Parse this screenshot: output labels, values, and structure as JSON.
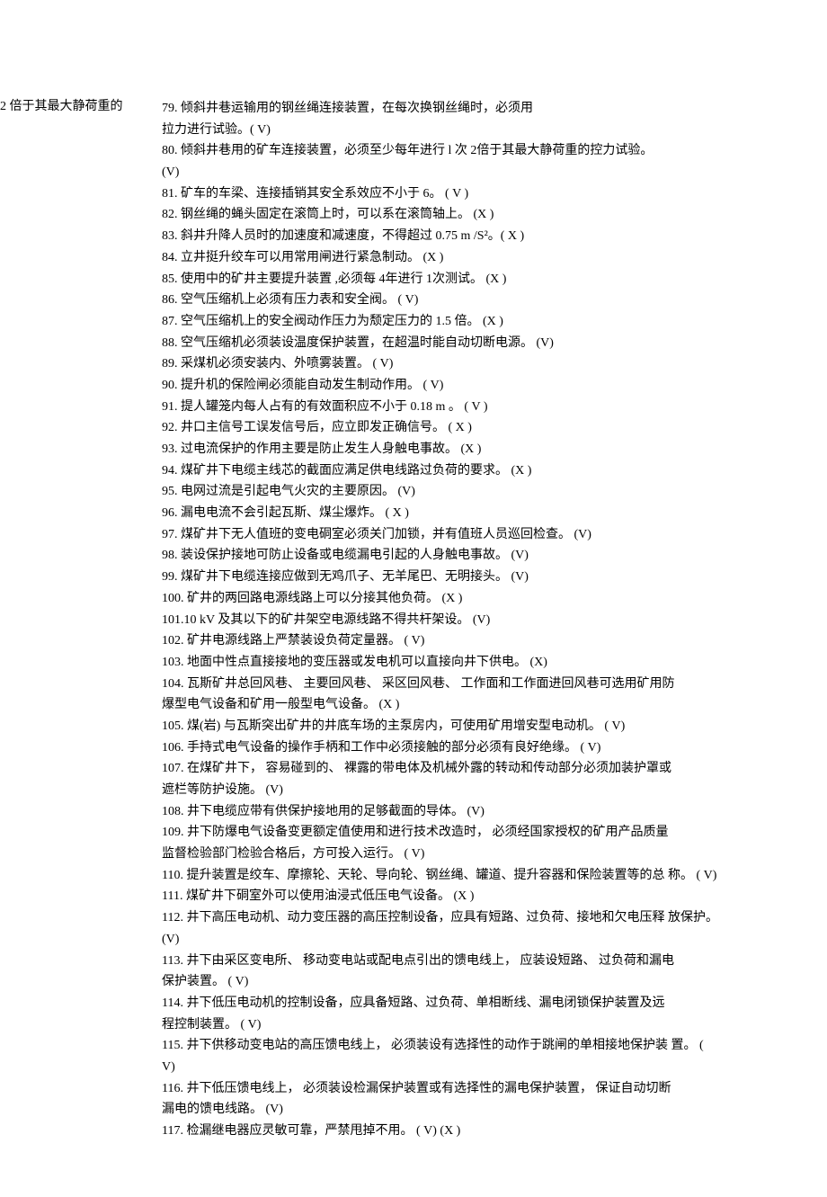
{
  "margin_note": "2 倍于其最大静荷重的",
  "items": [
    "79.  倾斜井巷运输用的钢丝绳连接装置，在每次换钢丝绳时，必须用",
    "拉力进行试验。( V)",
    "80.  倾斜井巷用的矿车连接装置，必须至少每年进行       l 次  2倍于其最大静荷重的控力试验。",
    "(V)",
    "81.  矿车的车梁、连接插销其安全系效应不小于       6。   ( V )",
    "82.  钢丝绳的蝇头固定在滚筒上时，可以系在滚筒轴上。         (X )",
    "83.  斜井升降人员时的加速度和减速度，不得超过       0.75 m /S²。( X )",
    "84.  立井挺升绞车可以用常用闸进行紧急制动。  (X )",
    "85.  使用中的矿井主要提升装置 ,必须每 4年进行 1次测试。  (X )",
    "86.  空气压缩机上必须有压力表和安全阀。     ( V)",
    "87.  空气压缩机上的安全阀动作压力为颓定压力的  1.5 倍。   (X )",
    "88.  空气压缩机必须装设温度保护装置，在超温时能自动切断电源。          (V)",
    "89.  采煤机必须安装内、外喷雾装置。  ( V)",
    "90.  提升机的保险闸必须能自动发生制动作用。  ( V)",
    "91.  提人罐笼内每人占有的有效面积应不小于  0.18 m 。   ( V )",
    "92.  井口主信号工误发信号后，应立即发正确信号。  ( X )",
    "93.  过电流保护的作用主要是防止发生人身触电事故。  (X )",
    "94.  煤矿井下电缆主线芯的截面应满足供电线路过负荷的要求。    (X )",
    "95.  电网过流是引起电气火灾的主要原因。      (V)",
    "96.  漏电电流不会引起瓦斯、煤尘爆炸。 ( X )",
    "97.  煤矿井下无人值班的变电硐室必须关门加锁，并有值班人员巡回检查。             (V)",
    "98.  装设保护接地可防止设备或电缆漏电引起的人身触电事故。         (V)",
    "99.  煤矿井下电缆连接应做到无鸡爪子、无羊尾巴、无明接头。         (V)",
    "100.   矿井的两回路电源线路上可以分接其他负荷。  (X )",
    "101.10 kV 及其以下的矿井架空电源线路不得共杆架设。         (V)",
    "102.  矿井电源线路上严禁装设负荷定量器。 ( V)",
    "103.  地面中性点直接接地的变压器或发电机可以直接向井下供电。             (X)",
    "104.  瓦斯矿井总回风巷、  主要回风巷、  采区回风巷、  工作面和工作面进回风巷可选用矿用防",
    "爆型电气设备和矿用一般型电气设备。  (X )",
    "105. 煤(岩) 与瓦斯突出矿井的井底车场的主泵房内，可使用矿用增安型电动机。            ( V)",
    "106.  手持式电气设备的操作手柄和工作中必须接触的部分必须有良好绝缘。            ( V)",
    "107.  在煤矿井下，  容易碰到的、  裸露的带电体及机械外露的转动和传动部分必须加装护罩或",
    "遮栏等防护设施。  (V)",
    "108.  井下电缆应带有供保护接地用的足够截面的导体。  (V)",
    "109.  井下防爆电气设备变更额定值使用和进行技术改造时，  必须经国家授权的矿用产品质量",
    "监督检验部门检验合格后，方可投入运行。   ( V)",
    "110. 提升装置是绞车、摩擦轮、天轮、导向轮、钢丝绳、罐道、提升容器和保险装置等的总 称。   ( V)",
    "111.  煤矿井下硐室外可以使用油浸式低压电气设备。  (X )",
    "112.  井下高压电动机、动力变压器的高压控制设备，应具有短路、过负荷、接地和欠电压释 放保护。",
    "(V)",
    "113.  井下由采区变电所、  移动变电站或配电点引出的馈电线上，  应装设短路、  过负荷和漏电",
    "保护装置。  ( V)",
    "114.  井下低压电动机的控制设备，应具备短路、过负荷、单相断线、漏电闭锁保护装置及远",
    "程控制装置。   ( V)",
    "115.  井下供移动变电站的高压馈电线上，  必须装设有选择性的动作于跳闸的单相接地保护装 置。  (",
    "V)",
    "116.  井下低压馈电线上，  必须装设检漏保护装置或有选择性的漏电保护装置，  保证自动切断",
    "漏电的馈电线路。  (V)",
    "117.  检漏继电器应灵敏可靠，严禁甩掉不用。  ( V)                          (X )"
  ],
  "item_classes": [
    "item",
    "item",
    "item",
    "item",
    "item",
    "item",
    "item",
    "item",
    "item",
    "item",
    "item",
    "item",
    "item",
    "item",
    "item",
    "item",
    "item",
    "item",
    "item",
    "item",
    "item",
    "item",
    "item",
    "item",
    "item",
    "item",
    "item",
    "item spaced",
    "item",
    "item",
    "item",
    "item spaced",
    "item",
    "item",
    "item spaced",
    "item",
    "item",
    "item",
    "item spaced",
    "item",
    "item spaced",
    "item",
    "item spaced",
    "item",
    "item",
    "item spaced",
    "item",
    "item spaced",
    "item"
  ]
}
